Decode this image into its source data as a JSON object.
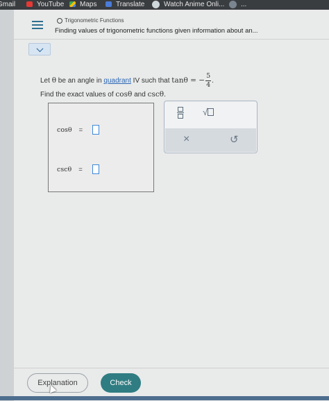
{
  "bookmarks": {
    "gmail": "Gmail",
    "youtube": "YouTube",
    "maps": "Maps",
    "translate": "Translate",
    "anime": "Watch Anime Onli...",
    "other": "..."
  },
  "header": {
    "topic": "Trigonometric Functions",
    "title": "Finding values of trigonometric functions given information about an..."
  },
  "problem": {
    "p1": "Let ",
    "theta": "θ",
    "p2": " be an angle in ",
    "quadrant_link": "quadrant",
    "p3": " IV such that ",
    "tan_expr": "tanθ = −",
    "frac_num": "5",
    "frac_den": "4",
    "period": ".",
    "p4": "Find the exact values of ",
    "cos_label": "cosθ",
    "and": " and ",
    "csc_label": "cscθ",
    "period2": "."
  },
  "answers": {
    "cos": "cosθ",
    "csc": "cscθ",
    "equals": "="
  },
  "toolbox": {
    "sqrt_symbol": "√",
    "clear_symbol": "×",
    "undo_symbol": "↺"
  },
  "footer": {
    "explanation": "Explanation",
    "check": "Check"
  },
  "colors": {
    "check_button": "#2f7d82",
    "link": "#2a67b4",
    "menu_icon": "#2f6f8f"
  }
}
